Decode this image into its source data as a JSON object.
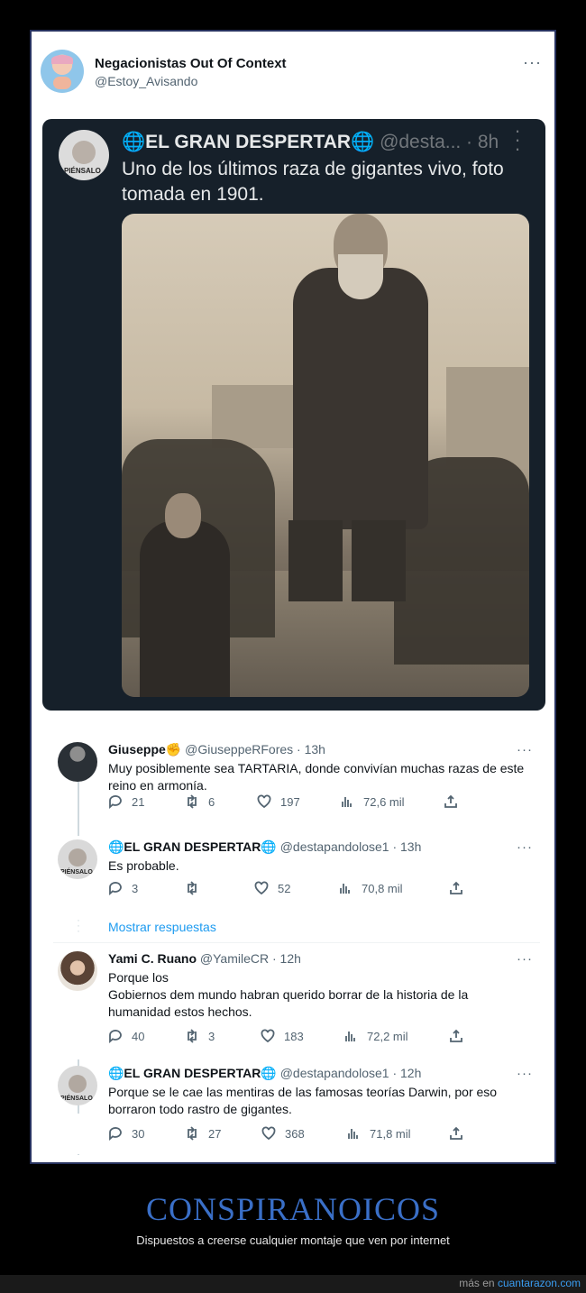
{
  "tweet": {
    "author_name": "Negacionistas Out Of Context",
    "author_handle": "@Estoy_Avisando",
    "more": "···"
  },
  "embed": {
    "name": "🌐EL GRAN DESPERTAR🌐",
    "handle": "@desta...",
    "time": "· 8h",
    "text": "Uno de los últimos  raza de gigantes vivo,  foto tomada en 1901.",
    "avatar_text": "PIÉNSALO"
  },
  "replies": [
    {
      "name": "Giuseppe✊",
      "handle": "@GiuseppeRFores · 13h",
      "text": "Muy posiblemente sea TARTARIA, donde convivían muchas razas de este reino en armonía.",
      "reply_count": "21",
      "retweet_count": "6",
      "like_count": "197",
      "views": "72,6 mil"
    },
    {
      "name": "🌐EL GRAN DESPERTAR🌐",
      "handle": "@destapandolose1 · 13h",
      "text": "Es probable.",
      "reply_count": "3",
      "retweet_count": "",
      "like_count": "52",
      "views": "70,8 mil",
      "avatar_text": "PIÉNSALO"
    },
    {
      "name": "Yami C. Ruano",
      "handle": "@YamileCR · 12h",
      "text": "Porque los\nGobiernos dem mundo habran querido borrar de la historia de la humanidad estos hechos.",
      "reply_count": "40",
      "retweet_count": "3",
      "like_count": "183",
      "views": "72,2 mil"
    },
    {
      "name": "🌐EL GRAN DESPERTAR🌐",
      "handle": "@destapandolose1 · 12h",
      "text": "Porque se le cae las mentiras de las famosas teorías  Darwin, por eso borraron todo rastro de gigantes.",
      "reply_count": "30",
      "retweet_count": "27",
      "like_count": "368",
      "views": "71,8 mil",
      "avatar_text": "PIÉNSALO"
    }
  ],
  "show_replies": "Mostrar respuestas",
  "footer": {
    "title": "CONSPIRANOICOS",
    "subtitle": "Dispuestos a creerse cualquier montaje que ven por internet",
    "more_prefix": "más en",
    "more_link": "cuantarazon.com"
  }
}
